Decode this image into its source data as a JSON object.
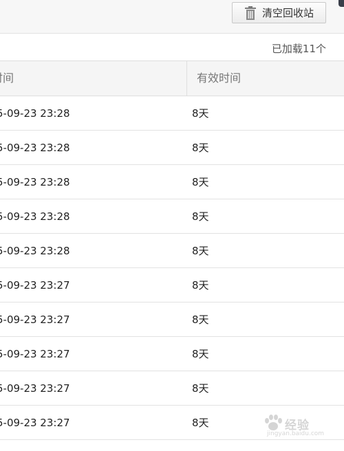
{
  "toolbar": {
    "clear_button_label": "清空回收站",
    "clear_button_icon": "trash-icon"
  },
  "status": {
    "loaded_count_text": "已加载11个"
  },
  "table": {
    "columns": [
      {
        "key": "deleted_time",
        "label": "时间"
      },
      {
        "key": "valid_time",
        "label": "有效时间"
      }
    ],
    "rows": [
      {
        "deleted_time": "5-09-23 23:28",
        "valid_time": "8天"
      },
      {
        "deleted_time": "5-09-23 23:28",
        "valid_time": "8天"
      },
      {
        "deleted_time": "5-09-23 23:28",
        "valid_time": "8天"
      },
      {
        "deleted_time": "5-09-23 23:28",
        "valid_time": "8天"
      },
      {
        "deleted_time": "5-09-23 23:28",
        "valid_time": "8天"
      },
      {
        "deleted_time": "5-09-23 23:27",
        "valid_time": "8天"
      },
      {
        "deleted_time": "5-09-23 23:27",
        "valid_time": "8天"
      },
      {
        "deleted_time": "5-09-23 23:27",
        "valid_time": "8天"
      },
      {
        "deleted_time": "5-09-23 23:27",
        "valid_time": "8天"
      },
      {
        "deleted_time": "5-09-23 23:27",
        "valid_time": "8天"
      }
    ]
  },
  "watermark": {
    "brand": "经验",
    "url": "jingyan.baidu.com"
  },
  "colors": {
    "toolbar_bg": "#f7f7f7",
    "header_bg": "#f5f5f5",
    "border": "#dedede",
    "text": "#222222",
    "muted_text": "#777777"
  }
}
